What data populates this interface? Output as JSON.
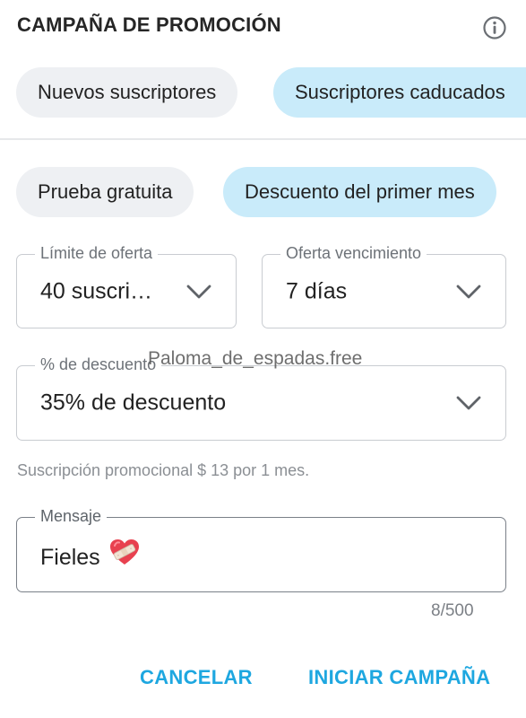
{
  "header": {
    "title": "CAMPAÑA DE PROMOCIÓN",
    "info_icon": "info-circle-icon"
  },
  "audience_tabs": [
    {
      "label": "Nuevos suscriptores",
      "selected": false
    },
    {
      "label": "Suscriptores caducados",
      "selected": true
    }
  ],
  "offer_type_tabs": [
    {
      "label": "Prueba gratuita",
      "selected": false
    },
    {
      "label": "Descuento del primer mes",
      "selected": true
    }
  ],
  "fields": {
    "offer_limit": {
      "label": "Límite de oferta",
      "value": "40 suscri…"
    },
    "offer_expiration": {
      "label": "Oferta vencimiento",
      "value": "7 días"
    },
    "discount": {
      "label": "% de descuento",
      "value": "35% de descuento"
    }
  },
  "watermark": "Paloma_de_espadas.free",
  "helper_text": "Suscripción promocional $ 13 por 1 mes.",
  "message": {
    "label": "Mensaje",
    "value": "Fieles",
    "emoji": "mending-heart-icon",
    "counter": "8/500"
  },
  "actions": {
    "cancel": "CANCELAR",
    "start": "INICIAR CAMPAÑA"
  },
  "colors": {
    "accent": "#1ea7e0",
    "chip_selected": "#c9ebfa",
    "chip_unselected": "#eef0f3"
  }
}
